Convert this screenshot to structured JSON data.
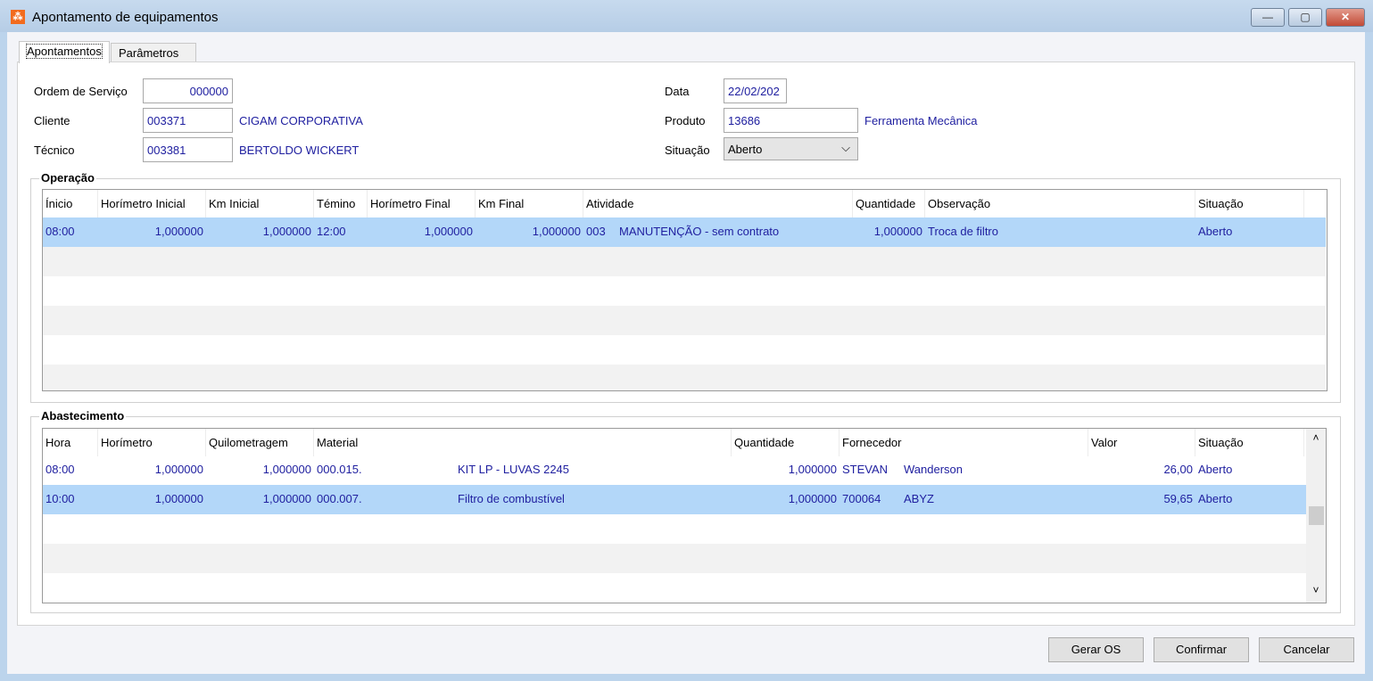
{
  "window": {
    "title": "Apontamento de equipamentos",
    "icon": "app-logo-icon",
    "minimize": "—",
    "maximize": "▢",
    "close": "✕"
  },
  "tabs": [
    {
      "label": "Apontamentos",
      "active": true
    },
    {
      "label": "Parâmetros",
      "active": false
    }
  ],
  "form": {
    "ordem_label": "Ordem de Serviço",
    "ordem_value": "000000",
    "cliente_label": "Cliente",
    "cliente_code": "003371",
    "cliente_name": "CIGAM CORPORATIVA",
    "tecnico_label": "Técnico",
    "tecnico_code": "003381",
    "tecnico_name": "BERTOLDO WICKERT",
    "data_label": "Data",
    "data_value": "22/02/202",
    "produto_label": "Produto",
    "produto_code": "13686",
    "produto_name": "Ferramenta Mecânica",
    "situacao_label": "Situação",
    "situacao_value": "Aberto",
    "chevron": "⌵"
  },
  "operacao": {
    "title": "Operação",
    "columns": [
      "Ínicio",
      "Horímetro Inicial",
      "Km Inicial",
      "Témino",
      "Horímetro Final",
      "Km Final",
      "Atividade",
      "Quantidade",
      "Observação",
      "Situação"
    ],
    "rows": [
      {
        "inicio": "08:00",
        "hor_ini": "1,000000",
        "km_ini": "1,000000",
        "termino": "12:00",
        "hor_fin": "1,000000",
        "km_fin": "1,000000",
        "ativ_code": "003",
        "ativ_name": "MANUTENÇÃO - sem contrato",
        "quantidade": "1,000000",
        "observacao": "Troca de filtro",
        "situacao": "Aberto"
      }
    ]
  },
  "abastecimento": {
    "title": "Abastecimento",
    "columns": [
      "Hora",
      "Horímetro",
      "Quilometragem",
      "Material",
      "Quantidade",
      "Fornecedor",
      "Valor",
      "Situação"
    ],
    "rows": [
      {
        "hora": "08:00",
        "horimetro": "1,000000",
        "km": "1,000000",
        "mat_code": "000.015.",
        "mat_name": "KIT LP - LUVAS 2245",
        "quantidade": "1,000000",
        "forn_code": "STEVAN",
        "forn_name": "Wanderson",
        "valor": "26,00",
        "situacao": "Aberto"
      },
      {
        "hora": "10:00",
        "horimetro": "1,000000",
        "km": "1,000000",
        "mat_code": "000.007.",
        "mat_name": "Filtro de combustível",
        "quantidade": "1,000000",
        "forn_code": "700064",
        "forn_name": "ABYZ",
        "valor": "59,65",
        "situacao": "Aberto"
      }
    ],
    "scroll_up": "˄",
    "scroll_down": "˅"
  },
  "buttons": {
    "gerar": "Gerar OS",
    "confirmar": "Confirmar",
    "cancelar": "Cancelar"
  }
}
